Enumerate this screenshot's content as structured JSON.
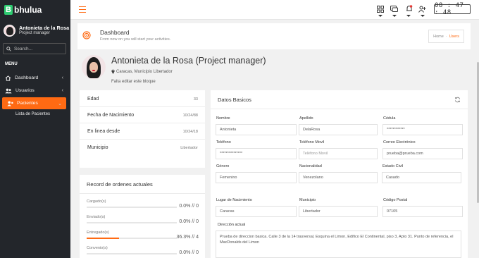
{
  "app": {
    "logo_letter": "B",
    "logo_text": "bhulua"
  },
  "user": {
    "name": "Antonieta de la Rosa",
    "role": "Project manager"
  },
  "search": {
    "placeholder": "Search..."
  },
  "menu": {
    "heading": "MENU",
    "items": [
      {
        "label": "Dashboard",
        "icon": "home-icon"
      },
      {
        "label": "Usuarios",
        "icon": "users-icon"
      },
      {
        "label": "Pacientes",
        "icon": "patients-icon",
        "active": true
      }
    ],
    "subitem": "Lista de Pacientes"
  },
  "topbar": {
    "clock": "08 : 47 : 48"
  },
  "header": {
    "title": "Dashboard",
    "subtitle": "From now on you will start your activities.",
    "breadcrumb": {
      "home": "Home",
      "sep": "-",
      "current": "Users"
    }
  },
  "profile": {
    "name": "Antonieta de la Rosa (Project manager)",
    "location": "Caracas, Municipio Libertador",
    "note": "Falta editar este bloque"
  },
  "info": [
    {
      "label": "Edad",
      "value": "33"
    },
    {
      "label": "Fecha de Nacimiento",
      "value": "10/24/88"
    },
    {
      "label": "En linea desde",
      "value": "10/24/18"
    },
    {
      "label": "Municipio",
      "value": "Libertador"
    }
  ],
  "orders": {
    "title": "Record de ordenes actuales",
    "rows": [
      {
        "label": "Cargado(s)",
        "value": "0.0% // 0",
        "progress": 0
      },
      {
        "label": "Enviado(s)",
        "value": "0.0% // 0",
        "progress": 0
      },
      {
        "label": "Entregado(s)",
        "value": "36.3% // 4",
        "progress": 36.3
      },
      {
        "label": "Convenio(s)",
        "value": "0.0% // 0",
        "progress": 0
      }
    ]
  },
  "datos": {
    "title": "Datos Basicos",
    "fields": {
      "nombre": {
        "label": "Nombre",
        "value": "Antonieta"
      },
      "apellido": {
        "label": "Apellido",
        "value": "DelaRosa"
      },
      "cedula": {
        "label": "Cédula",
        "value": "************"
      },
      "telefono": {
        "label": "Teléfono",
        "value": "***************"
      },
      "movil": {
        "label": "Teléfono Movil",
        "placeholder": "Teléfono Movil"
      },
      "correo": {
        "label": "Correo Electrónico",
        "value": "prueba@prueba.com"
      },
      "genero": {
        "label": "Género",
        "value": "Femenino"
      },
      "nacionalidad": {
        "label": "Nacionalidad",
        "value": "Venezolano"
      },
      "civil": {
        "label": "Estado Civil",
        "value": "Casado"
      },
      "lugar": {
        "label": "Lugar de Nacimiento",
        "value": "Caracas"
      },
      "municipio": {
        "label": "Municipio",
        "value": "Libertador"
      },
      "postal": {
        "label": "Código Postal",
        "value": "07105"
      },
      "direccion": {
        "label": "Dirección actual",
        "value": "Prueba de direccion basica. Calle 3 de la 14 trasversal, Esquina el Limon, Edifico El Continental, piso 3, Apto 31. Punto de referencia, el MacDonalds del Limon"
      }
    }
  },
  "colors": {
    "accent": "#ff6a13",
    "sidebar": "#23262b",
    "logo": "#2ecc71"
  }
}
